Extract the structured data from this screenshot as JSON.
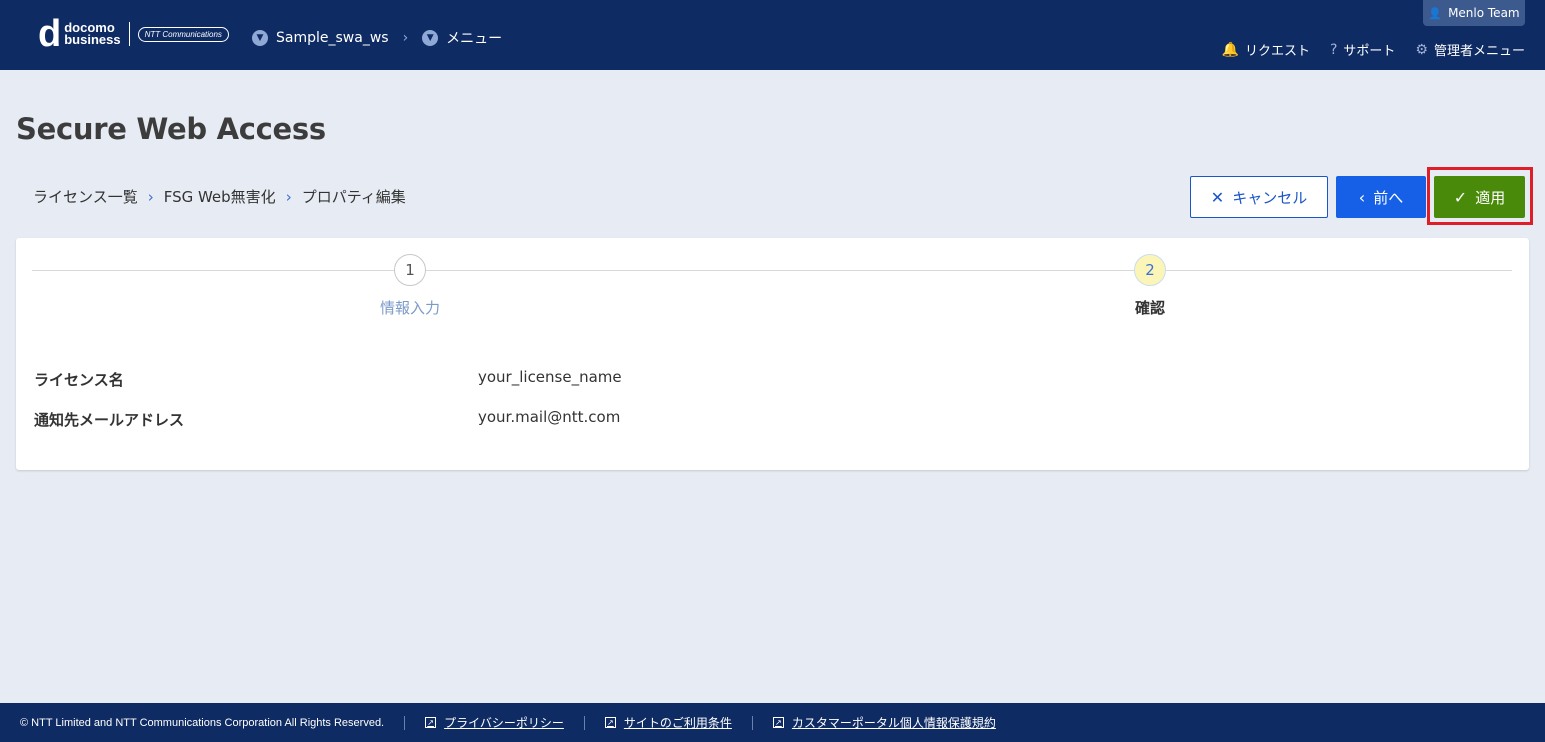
{
  "header": {
    "logo": {
      "d": "d",
      "line1": "docomo",
      "line2": "business",
      "ntt": "NTT Communications"
    },
    "nav": {
      "workspace": "Sample_swa_ws",
      "menu": "メニュー"
    },
    "team": "Menlo Team",
    "links": {
      "request": "リクエスト",
      "support": "サポート",
      "admin": "管理者メニュー"
    }
  },
  "page": {
    "title": "Secure Web Access"
  },
  "breadcrumb": {
    "items": [
      "ライセンス一覧",
      "FSG Web無害化",
      "プロパティ編集"
    ]
  },
  "actions": {
    "cancel": "キャンセル",
    "back": "前へ",
    "apply": "適用"
  },
  "steps": [
    {
      "num": "1",
      "label": "情報入力",
      "state": "done"
    },
    {
      "num": "2",
      "label": "確認",
      "state": "active"
    }
  ],
  "fields": [
    {
      "label": "ライセンス名",
      "value": "your_license_name"
    },
    {
      "label": "通知先メールアドレス",
      "value": "your.mail@ntt.com"
    }
  ],
  "footer": {
    "copyright": "© NTT Limited and NTT Communications Corporation All Rights Reserved.",
    "links": [
      "プライバシーポリシー",
      "サイトのご利用条件",
      "カスタマーポータル個人情報保護規約"
    ]
  },
  "colors": {
    "header_bg": "#0f2b63",
    "apply": "#4a8a0b",
    "back": "#1660e8",
    "highlight": "#e01e28"
  }
}
